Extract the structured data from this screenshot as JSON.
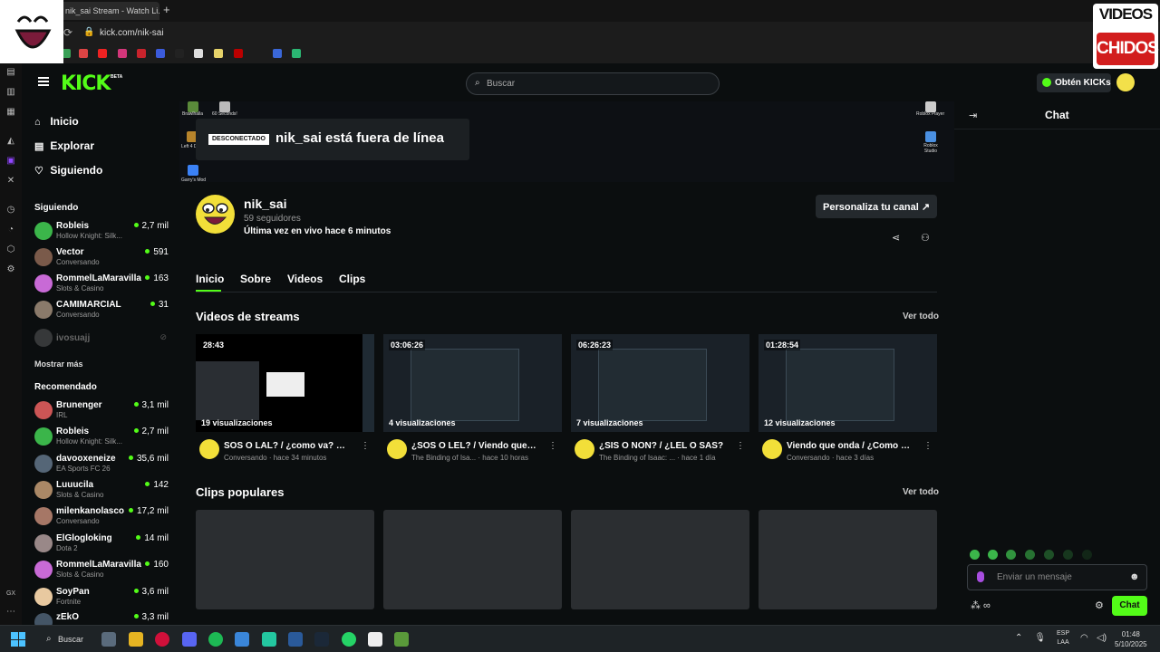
{
  "browser": {
    "tab_title": "nik_sai Stream - Watch Li...",
    "new_tab": "+",
    "url": "kick.com/nik-sai"
  },
  "overlay": {
    "brand_top": "VIDEOS",
    "brand_bottom": "CHIDOS"
  },
  "header": {
    "logo": "KICK",
    "logo_badge": "BETA",
    "search_placeholder": "Buscar",
    "get_kicks": "Obtén KICKs"
  },
  "sidebar": {
    "nav": [
      {
        "label": "Inicio",
        "icon": "home-icon"
      },
      {
        "label": "Explorar",
        "icon": "explore-icon"
      },
      {
        "label": "Siguiendo",
        "icon": "heart-icon"
      }
    ],
    "following_title": "Siguiendo",
    "following": [
      {
        "name": "Robleis",
        "game": "Hollow Knight: Silk...",
        "viewers": "2,7 mil",
        "color": "#3bb54a"
      },
      {
        "name": "Vector",
        "game": "Conversando",
        "viewers": "591",
        "color": "#7a5a4a"
      },
      {
        "name": "RommelLaMaravilla",
        "game": "Slots & Casino",
        "viewers": "163",
        "color": "#c86ad6"
      },
      {
        "name": "CAMIMARCIAL",
        "game": "Conversando",
        "viewers": "31",
        "color": "#8a7a6a"
      },
      {
        "name": "ivosuajj",
        "game": "",
        "viewers": "",
        "color": "#777"
      }
    ],
    "show_more": "Mostrar más",
    "recommended_title": "Recomendado",
    "recommended": [
      {
        "name": "Brunenger",
        "game": "IRL",
        "viewers": "3,1 mil",
        "color": "#c55"
      },
      {
        "name": "Robleis",
        "game": "Hollow Knight: Silk...",
        "viewers": "2,7 mil",
        "color": "#3bb54a"
      },
      {
        "name": "davooxeneize",
        "game": "EA Sports FC 26",
        "viewers": "35,6 mil",
        "color": "#556677"
      },
      {
        "name": "Luuucila",
        "game": "Slots & Casino",
        "viewers": "142",
        "color": "#aa8866"
      },
      {
        "name": "milenkanolasco",
        "game": "Conversando",
        "viewers": "17,2 mil",
        "color": "#a67766"
      },
      {
        "name": "ElGlogloking",
        "game": "Dota 2",
        "viewers": "14 mil",
        "color": "#998888"
      },
      {
        "name": "RommelLaMaravilla",
        "game": "Slots & Casino",
        "viewers": "160",
        "color": "#c86ad6"
      },
      {
        "name": "SoyPan",
        "game": "Fortnite",
        "viewers": "3,6 mil",
        "color": "#e8c9a0"
      },
      {
        "name": "zEkO",
        "game": "",
        "viewers": "3,3 mil",
        "color": "#445566"
      }
    ]
  },
  "banner": {
    "offline_tag": "DESCONECTADO",
    "offline_text": "nik_sai está fuera de línea",
    "desktop_labels": [
      "Brawlhalla",
      "60 Seconds!",
      "Left 4 D",
      "Garry's Mod",
      "Roblox Player",
      "Roblox Studio"
    ]
  },
  "channel": {
    "name": "nik_sai",
    "followers": "59 seguidores",
    "last_live": "Última vez en vivo hace 6 minutos",
    "customize": "Personaliza tu canal ↗"
  },
  "tabs": [
    "Inicio",
    "Sobre",
    "Videos",
    "Clips"
  ],
  "videos_section": {
    "title": "Videos de streams",
    "see_all": "Ver todo",
    "items": [
      {
        "duration": "28:43",
        "views": "19 visualizaciones",
        "title": "SOS O LAL? / ¿como va? 🚀 ...",
        "category": "Conversando",
        "ago": "hace 34 minutos"
      },
      {
        "duration": "03:06:26",
        "views": "4 visualizaciones",
        "title": "¿SOS O LEL? / Viendo que on...",
        "category": "The Binding of Isa...",
        "ago": "hace 10 horas"
      },
      {
        "duration": "06:26:23",
        "views": "7 visualizaciones",
        "title": "¿SIS O NON? / ¿LEL O SAS?",
        "category": "The Binding of Isaac: ...",
        "ago": "hace 1 día"
      },
      {
        "duration": "01:28:54",
        "views": "12 visualizaciones",
        "title": "Viendo que onda / ¿Como an...",
        "category": "Conversando",
        "ago": "hace 3 días"
      }
    ]
  },
  "clips_section": {
    "title": "Clips populares",
    "see_all": "Ver todo"
  },
  "chat": {
    "title": "Chat",
    "placeholder": "Enviar un mensaje",
    "button": "Chat"
  },
  "taskbar": {
    "search": "Buscar",
    "lang_1": "ESP",
    "lang_2": "LAA",
    "time": "01:48",
    "date": "5/10/2025"
  },
  "colors": {
    "accent": "#53fc18",
    "background": "#0b0e0f"
  }
}
